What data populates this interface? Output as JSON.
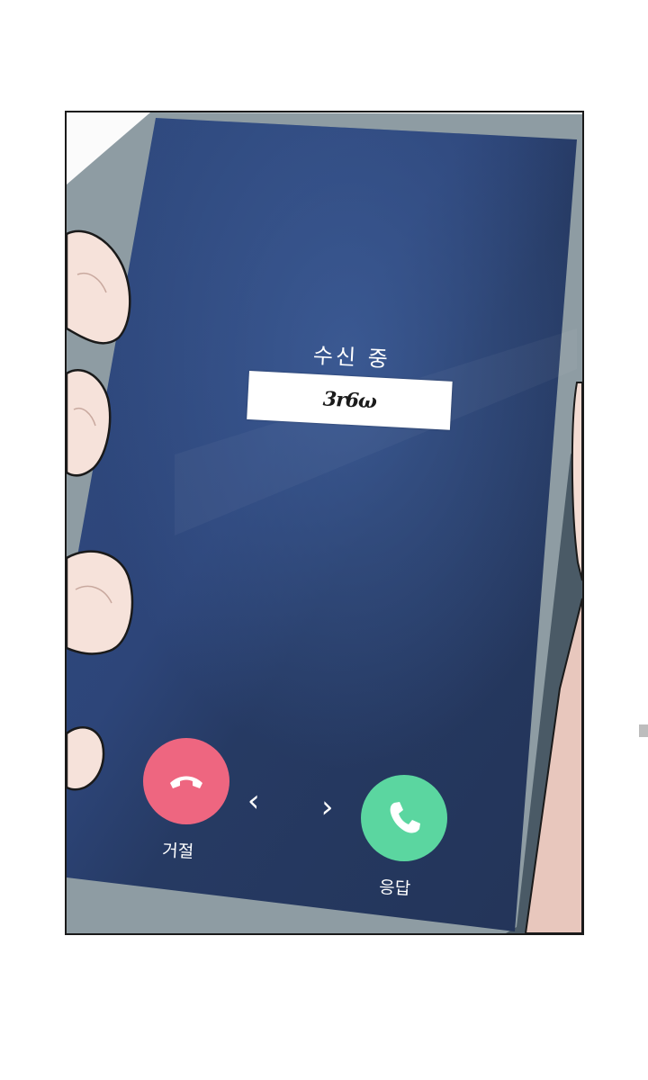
{
  "call_screen": {
    "status_text": "수신 중",
    "caller_name": "3r6ω",
    "decline_label": "거절",
    "accept_label": "응답",
    "swipe_left_hint": "‹",
    "swipe_right_hint": "›"
  },
  "colors": {
    "screen_background": "#2b3d66",
    "decline_button": "#ee6680",
    "accept_button": "#5bd6a0",
    "phone_frame": "#7f8f98"
  },
  "icons": {
    "decline": "phone-hangup-icon",
    "accept": "phone-answer-icon",
    "left": "chevron-left-icon",
    "right": "chevron-right-icon"
  }
}
